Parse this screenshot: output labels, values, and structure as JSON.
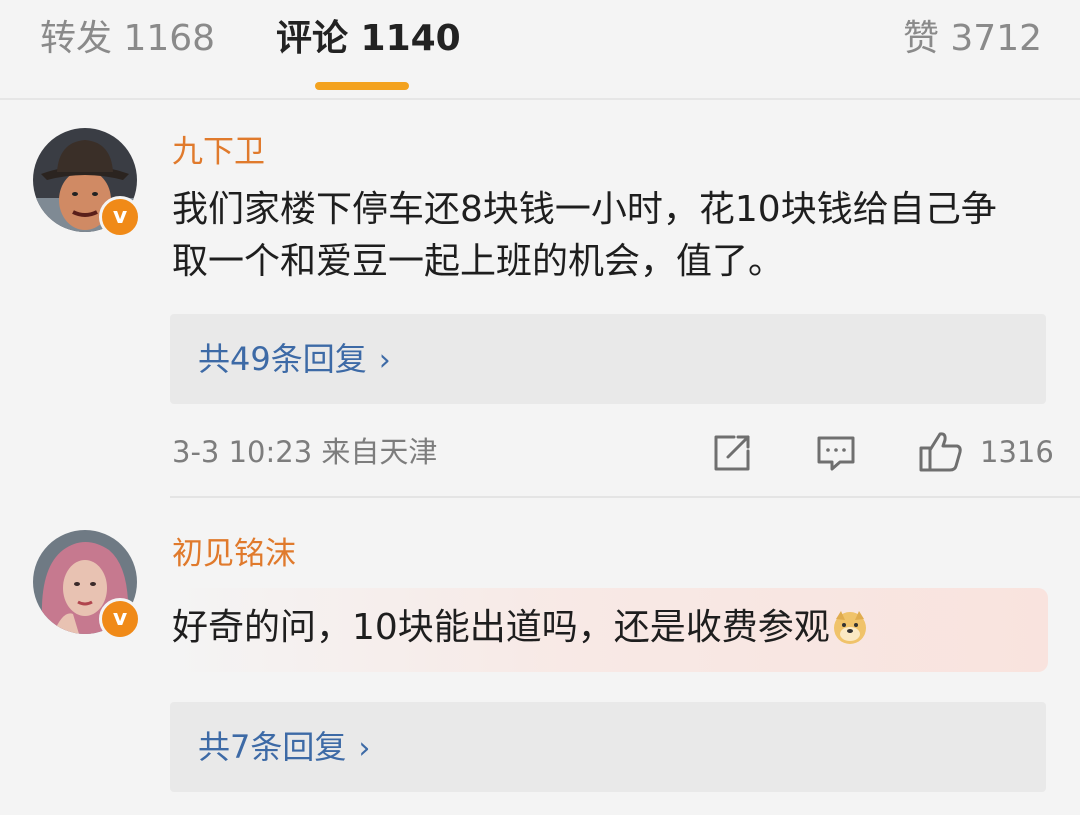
{
  "tabs": [
    {
      "label": "转发 1168"
    },
    {
      "label": "评论 1140"
    },
    {
      "label": "赞 3712"
    }
  ],
  "comments": [
    {
      "username": "九下卫",
      "text": "我们家楼下停车还8块钱一小时，花10块钱给自己争取一个和爱豆一起上班的机会，值了。",
      "replies": "共49条回复",
      "meta": "3-3 10:23  来自天津",
      "likes": "1316"
    },
    {
      "username": "初见铭沫",
      "text": "好奇的问，10块能出道吗，还是收费参观",
      "replies": "共7条回复"
    }
  ],
  "icons": {
    "badge": "verified-v-icon",
    "reply_chevron": "chevron-right-icon",
    "share": "share-icon",
    "comment": "comment-icon",
    "like": "thumbs-up-icon",
    "emoji": "doge-emoji-icon"
  },
  "colors": {
    "accent": "#f3a21f",
    "username": "#e07a2c",
    "link": "#3d6aa6",
    "badge": "#f08a18"
  }
}
